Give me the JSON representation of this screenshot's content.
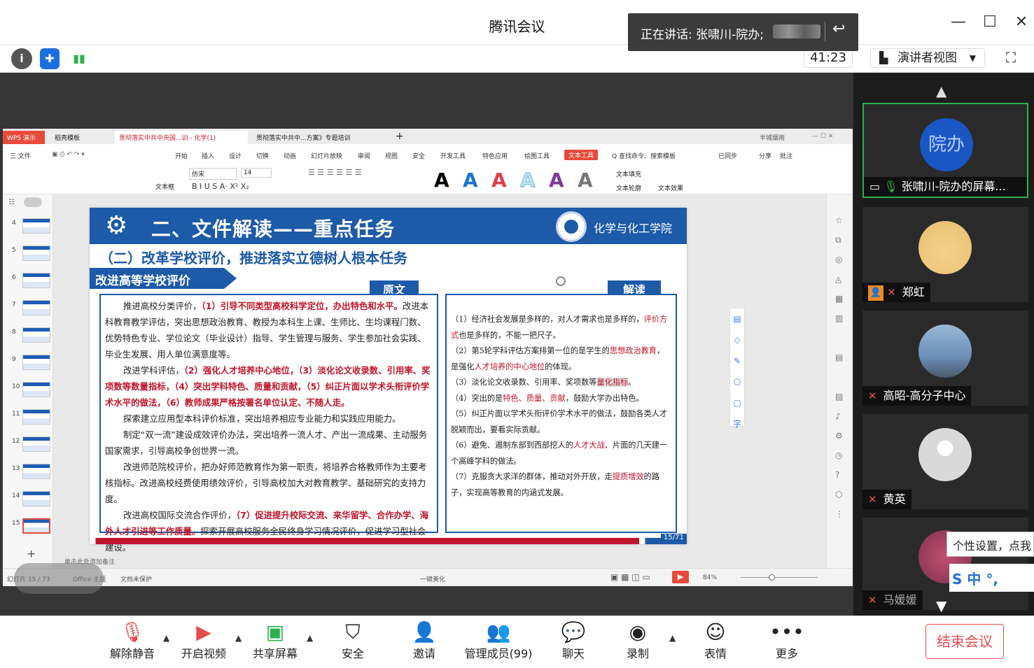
{
  "window": {
    "title": "腾讯会议",
    "speaking": "正在讲话: 张啸川-院办;",
    "timer": "41:23",
    "view_mode": "演讲者视图"
  },
  "icons": {
    "info": "info-icon",
    "shield": "shield-icon",
    "signal": "signal-icon"
  },
  "wps": {
    "tabs": [
      "WPS 演示",
      "稻壳模板",
      "贯彻落实中共中央国...训 - 化学(1)",
      "贯彻落实中共中...方案》专题培训"
    ],
    "menu": [
      "三 文件",
      "开始",
      "插入",
      "设计",
      "切换",
      "动画",
      "幻灯片放映",
      "审阅",
      "视图",
      "安全",
      "开发工具",
      "特色应用",
      "绘图工具",
      "文本工具",
      "Q 查找命令、搜索模板",
      "已同步",
      "分享",
      "批注"
    ],
    "ribbon": {
      "textbox": "文本框",
      "font": "仿宋",
      "size": "14",
      "fill": "文本填充",
      "outline": "文本轮廓",
      "effect": "文本效果",
      "user": "半城烟雨"
    },
    "thumb_numbers": [
      "4",
      "5",
      "6",
      "7",
      "8",
      "9",
      "10",
      "11",
      "12",
      "13",
      "14",
      "15"
    ],
    "notes_placeholder": "单击此处添加备注",
    "status": {
      "slide": "幻灯片 15 / 73",
      "theme": "Office 主题",
      "protect": "文档未保护",
      "beautify": "一键美化",
      "zoom": "84%"
    }
  },
  "slide": {
    "header": "二、文件解读——重点任务",
    "college": "化学与化工学院",
    "subtitle": "（二）改革学校评价，推进落实立德树人根本任务",
    "section": "改进高等学校评价",
    "label_orig": "原文",
    "label_interp": "解读",
    "page": "15/71",
    "orig": [
      {
        "n": "推进高校分类评价，",
        "r": "（1）引导不同类型高校科学定位，办出特色和水平。",
        "t": "改进本科教育教学评估，突出思想政治教育、教授为本科生上课、生师比、生均课程门数、优势特色专业、学位论文（毕业设计）指导、学生管理与服务、学生参加社会实践、毕业生发展、用人单位满意度等。"
      },
      {
        "n": "改进学科评估，",
        "r": "（2）强化人才培养中心地位，（3）淡化论文收录数、引用率、奖项数等数量指标，（4）突出学科特色、质量和贡献，（5）纠正片面以学术头衔评价学术水平的做法，（6）教师成果严格按署名单位认定、不随人走。",
        "t": ""
      },
      {
        "n": "探索建立应用型本科评价标准，突出培养相应专业能力和实践应用能力。",
        "r": "",
        "t": ""
      },
      {
        "n": "制定“双一流”建设成效评价办法，突出培养一流人才、产出一流成果、主动服务国家需求，引导高校争创世界一流。",
        "r": "",
        "t": ""
      },
      {
        "n": "改进师范院校评价，把办好师范教育作为第一职责，将培养合格教师作为主要考核指标。改进高校经费使用绩效评价，引导高校加大对教育教学、基础研究的支持力度。",
        "r": "",
        "t": ""
      },
      {
        "n": "改进高校国际交流合作评价，",
        "r": "（7）促进提升校际交流、来华留学、合作办学、海外人才引进等工作质量。",
        "t": "探索开展高校服务全民终身学习情况评价，促进学习型社会建设。"
      }
    ],
    "interp": [
      {
        "a": "（1）经济社会发展是多样的，对人才需求也是多样的，",
        "r": "评价方式",
        "b": "也是多样的，不能一把尺子。"
      },
      {
        "a": "（2）第5轮学科评估方案排第一位的是学生的",
        "r": "思想政治教育",
        "b": "，是强化",
        "r2": "人才培养的中心地位",
        "c": "的体现。"
      },
      {
        "a": "（3）淡化论文收录数、引用率、奖项数等",
        "r": "量化指标",
        "b": "。"
      },
      {
        "a": "（4）突出的是",
        "r": "特色、质量、贡献",
        "b": "，鼓励大学办出特色。"
      },
      {
        "a": "（5）纠正片面以学术头衔评价学术水平的做法，鼓励各类人才脱颖而出，要看实际贡献。",
        "r": "",
        "b": ""
      },
      {
        "a": "（6）避免、遏制东部到西部挖人的",
        "r": "人才大战",
        "b": "、片面的几天建一个高峰学科的做法。"
      },
      {
        "a": "（7）克服贪大求洋的群体，推动对外开放，走",
        "r": "提质增效",
        "b": "的路子，实现高等教育的内涵式发展。"
      }
    ]
  },
  "participants": [
    {
      "name": "张啸川-院办的屏幕...",
      "avatar_text": "院办",
      "color": "#1a56c4"
    },
    {
      "name": "郑虹",
      "color": "#e6c070"
    },
    {
      "name": "高昭-高分子中心",
      "color": "#6b8fb8"
    },
    {
      "name": "黄英",
      "color": "#d9d9d9"
    },
    {
      "name": "马媛媛",
      "color": "#a04060"
    }
  ],
  "tooltip": "个性设置，点我",
  "ime": "S 中 °,",
  "controls": [
    "解除静音",
    "开启视频",
    "共享屏幕",
    "安全",
    "邀请",
    "管理成员(99)",
    "聊天",
    "录制",
    "表情",
    "更多"
  ],
  "end_label": "结束会议"
}
